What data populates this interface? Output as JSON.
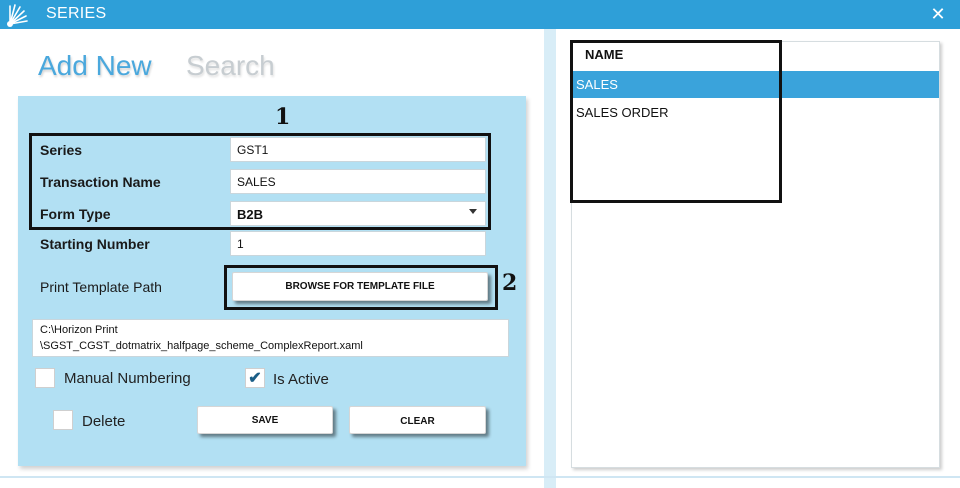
{
  "window": {
    "title": "SERIES",
    "close_glyph": "✕",
    "icon": "app-logo-icon",
    "accent_color": "#2e9fd8"
  },
  "tabs": {
    "add_new": "Add New",
    "search": "Search"
  },
  "form": {
    "series_label": "Series",
    "series_value": "GST1",
    "transaction_name_label": "Transaction Name",
    "transaction_name_value": "SALES",
    "form_type_label": "Form Type",
    "form_type_value": "B2B",
    "starting_number_label": "Starting Number",
    "starting_number_value": "1",
    "print_template_label": "Print Template Path",
    "browse_button": "BROWSE FOR TEMPLATE FILE",
    "template_path_line1": "C:\\Horizon Print",
    "template_path_line2": "\\SGST_CGST_dotmatrix_halfpage_scheme_ComplexReport.xaml",
    "manual_numbering_label": "Manual Numbering",
    "manual_numbering_checked": false,
    "is_active_label": "Is Active",
    "is_active_checked": true,
    "delete_label": "Delete",
    "delete_checked": false,
    "save_button": "SAVE",
    "clear_button": "CLEAR",
    "panel_color": "#b2e0f3"
  },
  "annotations": {
    "marker_1": "1",
    "marker_2": "2"
  },
  "list": {
    "header": "NAME",
    "items": [
      {
        "label": "SALES",
        "selected": true
      },
      {
        "label": "SALES ORDER",
        "selected": false
      }
    ],
    "selected_color": "#3aa3db"
  }
}
